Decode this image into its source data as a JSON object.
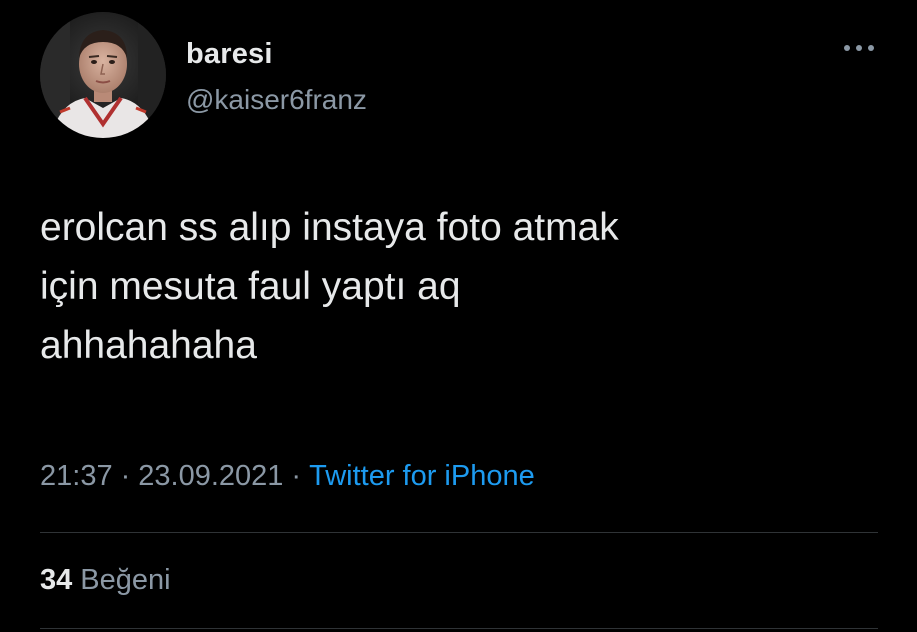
{
  "user": {
    "display_name": "baresi",
    "handle": "@kaiser6franz",
    "avatar_icon": "profile-photo"
  },
  "tweet": {
    "text": "erolcan ss alıp instaya foto atmak\niçin mesuta faul yaptı aq\nahhahahaha",
    "time": "21:37",
    "date": "23.09.2021",
    "separator": "·",
    "source": "Twitter for iPhone"
  },
  "stats": {
    "likes_count": "34",
    "likes_label": "Beğeni"
  },
  "icons": {
    "more": "more-horizontal-icon"
  },
  "colors": {
    "background": "#000000",
    "primary_text": "#e7e9ea",
    "secondary_text": "#8b98a5",
    "link": "#1d9bf0",
    "divider": "#2f3336"
  }
}
